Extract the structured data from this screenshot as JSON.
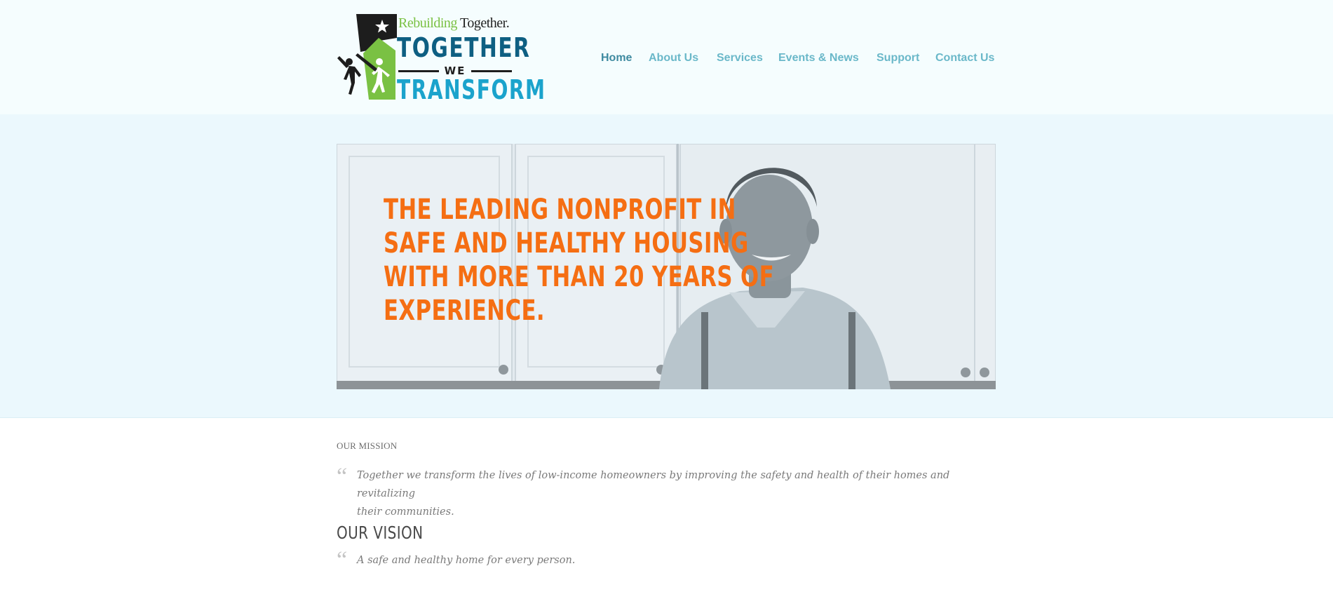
{
  "logo": {
    "tagline_green": "Rebuilding",
    "tagline_black": "Together.",
    "line1": "TOGETHER",
    "line2": "WE",
    "line3": "TRANSFORM",
    "colors": {
      "navy": "#0e5f82",
      "teal": "#1ba3cc",
      "green": "#7ac143",
      "dark": "#1d1d1d"
    }
  },
  "nav": {
    "items": [
      {
        "label": "Home",
        "active": true
      },
      {
        "label": "About Us"
      },
      {
        "label": "Services"
      },
      {
        "label": "Events & News"
      },
      {
        "label": "Support"
      },
      {
        "label": "Contact Us"
      }
    ]
  },
  "hero": {
    "headline_lines": [
      "THE LEADING NONPROFIT IN",
      "SAFE AND HEALTHY HOUSING",
      "WITH MORE THAN 20 YEARS OF",
      "EXPERIENCE."
    ],
    "accent_color": "#f56e13"
  },
  "mission": {
    "label": "OUR MISSION",
    "text_line1": "Together we transform the lives of low-income homeowners by improving the safety and health of their homes and revitalizing",
    "text_line2": "their communities."
  },
  "vision": {
    "title": "OUR VISION",
    "text": "A safe and healthy home for every person."
  }
}
